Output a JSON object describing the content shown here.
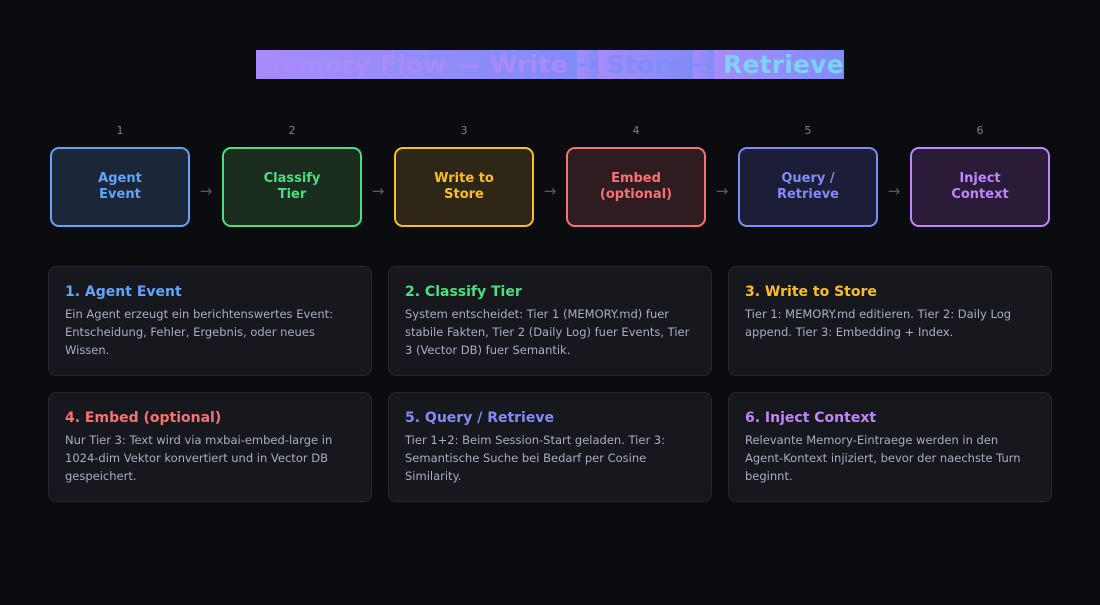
{
  "header": {
    "title_parts": [
      "Memory Flow — Write ",
      "→",
      " Store ",
      "→",
      " Retrieve"
    ],
    "gradient": [
      "#a78bfa",
      "#818cf8",
      "#7dd3fc"
    ]
  },
  "arrow_glyph": "→",
  "steps": [
    {
      "num": "1",
      "label": "Agent\nEvent",
      "color": "#60a5fa",
      "bg": "#1b2638"
    },
    {
      "num": "2",
      "label": "Classify\nTier",
      "color": "#4ade80",
      "bg": "#1a2c1e"
    },
    {
      "num": "3",
      "label": "Write to\nStore",
      "color": "#fbbf24",
      "bg": "#2e2717"
    },
    {
      "num": "4",
      "label": "Embed\n(optional)",
      "color": "#f87171",
      "bg": "#2f1c21"
    },
    {
      "num": "5",
      "label": "Query /\nRetrieve",
      "color": "#818cf8",
      "bg": "#1c1d36"
    },
    {
      "num": "6",
      "label": "Inject\nContext",
      "color": "#c084fc",
      "bg": "#2a1c38"
    }
  ],
  "cards": [
    {
      "title": "1. Agent Event",
      "color": "#60a5fa",
      "text": "Ein Agent erzeugt ein berichtenswertes Event: Entscheidung, Fehler, Ergebnis, oder neues Wissen."
    },
    {
      "title": "2. Classify Tier",
      "color": "#4ade80",
      "text": "System entscheidet: Tier 1 (MEMORY.md) fuer stabile Fakten, Tier 2 (Daily Log) fuer Events, Tier 3 (Vector DB) fuer Semantik."
    },
    {
      "title": "3. Write to Store",
      "color": "#fbbf24",
      "text": "Tier 1: MEMORY.md editieren. Tier 2: Daily Log append. Tier 3: Embedding + Index."
    },
    {
      "title": "4. Embed (optional)",
      "color": "#f87171",
      "text": "Nur Tier 3: Text wird via mxbai-embed-large in 1024-dim Vektor konvertiert und in Vector DB gespeichert."
    },
    {
      "title": "5. Query / Retrieve",
      "color": "#818cf8",
      "text": "Tier 1+2: Beim Session-Start geladen. Tier 3: Semantische Suche bei Bedarf per Cosine Similarity."
    },
    {
      "title": "6. Inject Context",
      "color": "#c084fc",
      "text": "Relevante Memory-Eintraege werden in den Agent-Kontext injiziert, bevor der naechste Turn beginnt."
    }
  ]
}
